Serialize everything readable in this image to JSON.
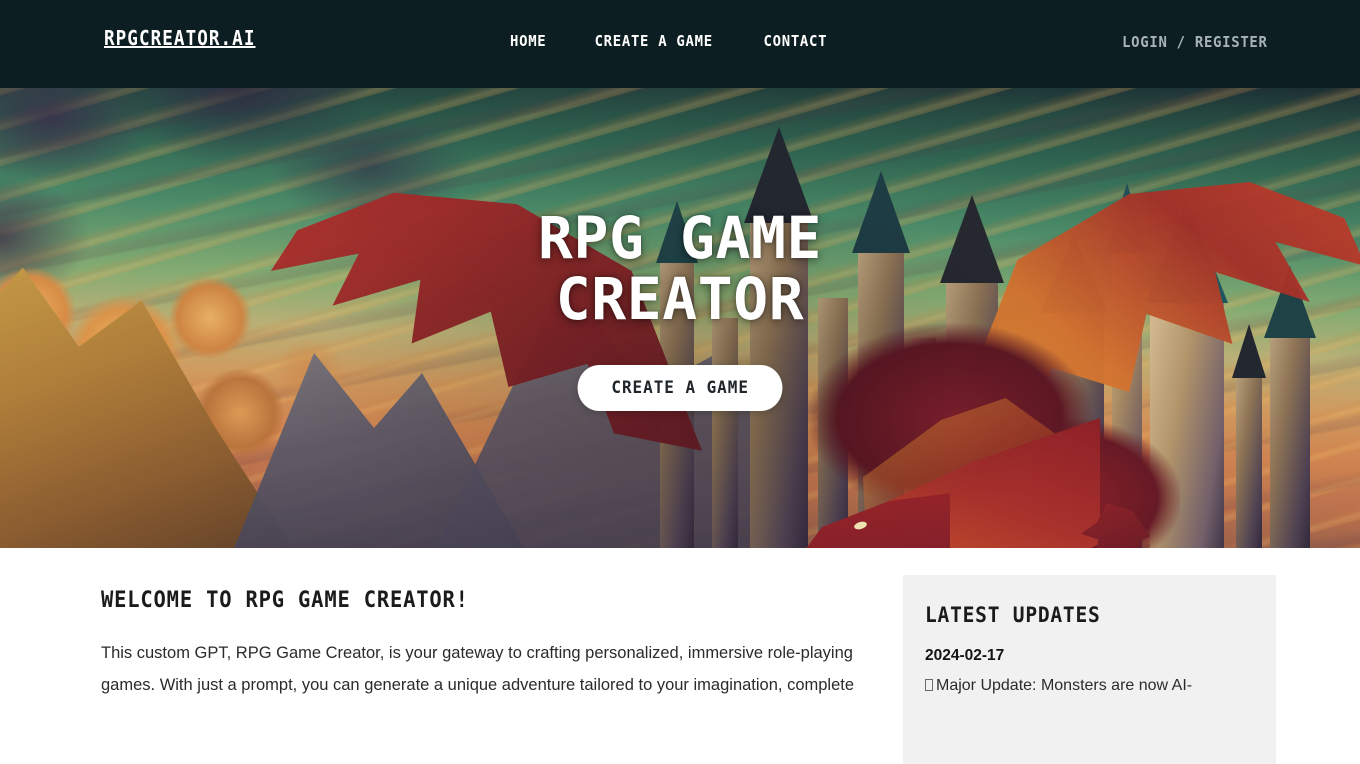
{
  "header": {
    "brand": "RPGCREATOR.AI",
    "nav": [
      {
        "label": "HOME"
      },
      {
        "label": "CREATE A GAME"
      },
      {
        "label": "CONTACT"
      }
    ],
    "auth_label": "LOGIN / REGISTER",
    "background_color": "#0d1e22",
    "brand_color": "#ffffff",
    "auth_color": "#a9b4b6"
  },
  "hero": {
    "title_line1": "RPG GAME",
    "title_line2": "CREATOR",
    "cta_label": "CREATE A GAME",
    "cta_background": "#ffffff",
    "cta_text_color": "#20262a",
    "artwork_alt": "Fantasy illustration of a red dragon flying over a gothic castle with mountains and a green sunset sky"
  },
  "main": {
    "welcome_title": "WELCOME TO RPG GAME CREATOR!",
    "welcome_body": "This custom GPT, RPG Game Creator, is your gateway to crafting personalized, immersive role-playing games. With just a prompt, you can generate a unique adventure tailored to your imagination, complete"
  },
  "sidebar": {
    "title": "LATEST UPDATES",
    "panel_background": "#f1f1f1",
    "updates": [
      {
        "date": "2024-02-17",
        "text": "Major Update: Monsters are now AI-"
      }
    ]
  }
}
